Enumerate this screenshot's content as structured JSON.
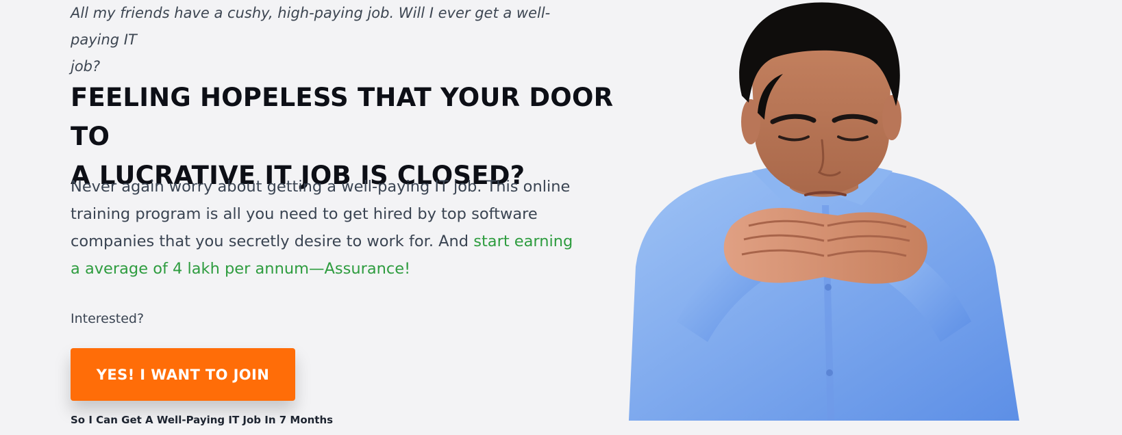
{
  "hero": {
    "quote_line_1": "All my friends have a cushy, high-paying job. Will I ever get a well-paying IT",
    "quote_line_2": "job?",
    "headline_line_1": "FEELING HOPELESS THAT YOUR DOOR TO",
    "headline_line_2": "A LUCRATIVE IT JOB IS CLOSED?",
    "body_text_1": "Never again worry about getting a well-paying IT job. This online training program is all you need to get hired by top software companies that you secretly desire to work for. And ",
    "body_highlight": "start earning a average of 4 lakh per annum—Assurance!",
    "interested_label": "Interested?",
    "cta_label": "YES! I WANT TO JOIN",
    "subcaption": "So I Can Get A Well-Paying IT Job In 7 Months"
  },
  "colors": {
    "background": "#f3f3f5",
    "headline": "#0d0f16",
    "body_text": "#3a4452",
    "highlight_green": "#2e9c3f",
    "cta_orange": "#ff6d08",
    "cta_text": "#ffffff"
  },
  "media": {
    "hero_image": "thoughtful-young-man-in-blue-shirt-with-hands-clasped"
  }
}
